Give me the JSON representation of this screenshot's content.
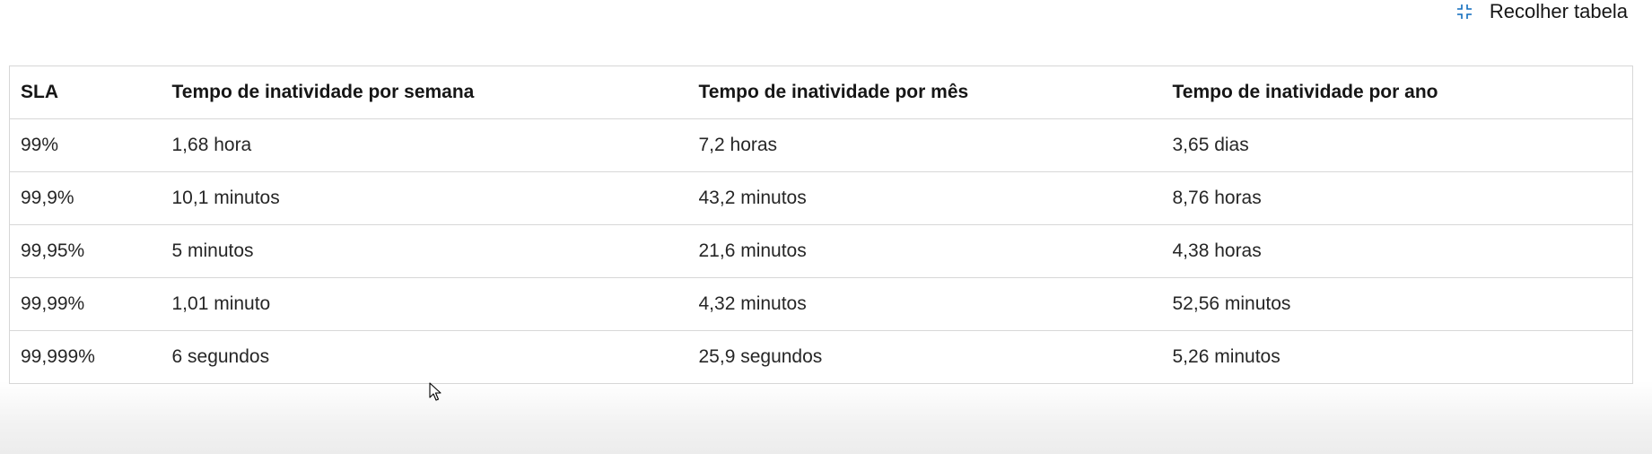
{
  "header": {
    "collapse_icon": "collapse-arrows-icon",
    "collapse_label": "Recolher tabela"
  },
  "table": {
    "columns": [
      "SLA",
      "Tempo de inatividade por semana",
      "Tempo de inatividade por mês",
      "Tempo de inatividade por ano"
    ],
    "rows": [
      [
        "99%",
        "1,68 hora",
        "7,2 horas",
        "3,65 dias"
      ],
      [
        "99,9%",
        "10,1 minutos",
        "43,2 minutos",
        "8,76 horas"
      ],
      [
        "99,95%",
        "5 minutos",
        "21,6 minutos",
        "4,38 horas"
      ],
      [
        "99,99%",
        "1,01 minuto",
        "4,32 minutos",
        "52,56 minutos"
      ],
      [
        "99,999%",
        "6 segundos",
        "25,9 segundos",
        "5,26 minutos"
      ]
    ]
  },
  "colors": {
    "accent_icon": "#0f6cbd",
    "border": "#d7d7d7",
    "text": "#161616"
  },
  "pointer": "mouse-pointer-icon"
}
